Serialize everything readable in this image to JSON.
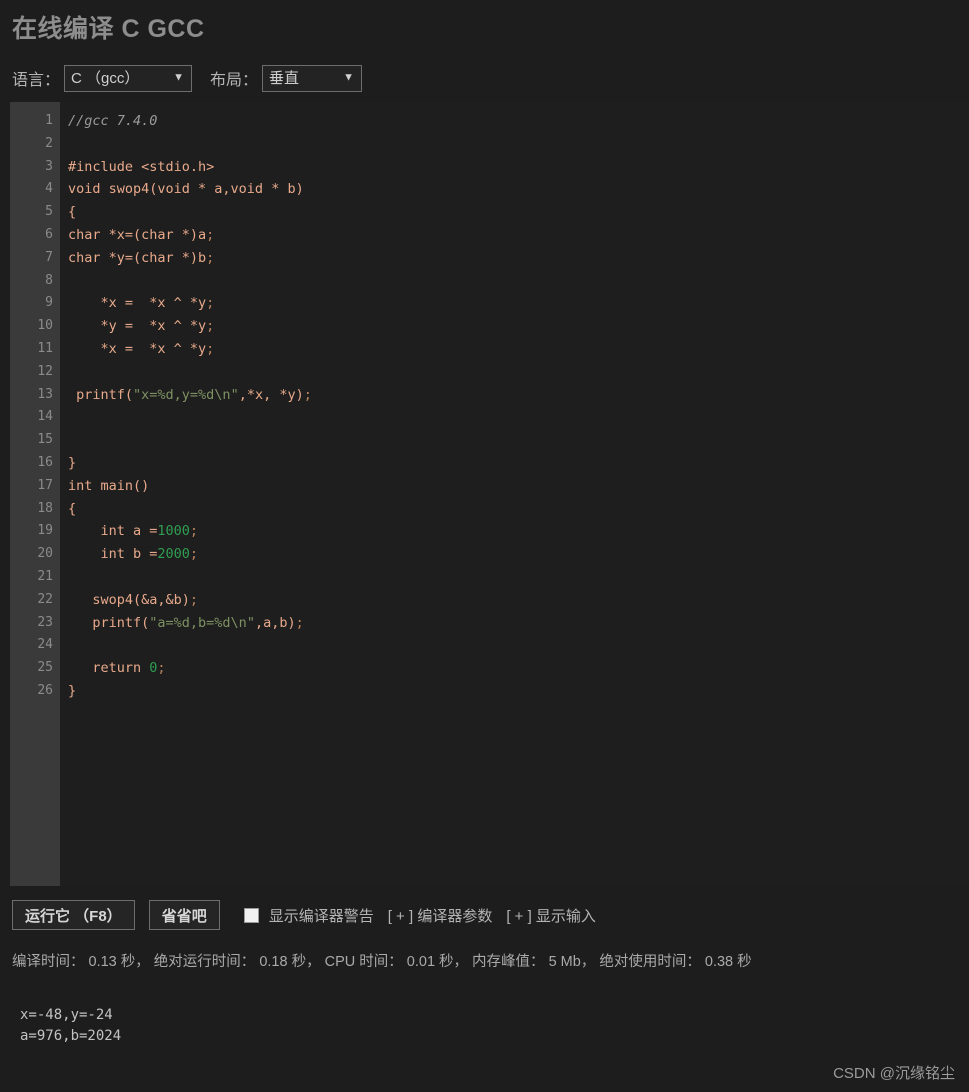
{
  "header": {
    "title": "在线编译 C GCC"
  },
  "options": {
    "language_label": "语言：",
    "language_value": "C （gcc）",
    "layout_label": "布局：",
    "layout_value": "垂直",
    "chevron_icon": "chevron-down-icon"
  },
  "editor": {
    "line_numbers": [
      "1",
      "2",
      "3",
      "4",
      "5",
      "6",
      "7",
      "8",
      "9",
      "10",
      "11",
      "12",
      "13",
      "14",
      "15",
      "16",
      "17",
      "18",
      "19",
      "20",
      "21",
      "22",
      "23",
      "24",
      "25",
      "26"
    ],
    "lines": [
      "//gcc 7.4.0",
      "",
      "#include <stdio.h>",
      "void swop4(void * a,void * b)",
      "{",
      "char *x=(char *)a;",
      "char *y=(char *)b;",
      "",
      "    *x =  *x ^ *y;",
      "    *y =  *x ^ *y;",
      "    *x =  *x ^ *y;",
      "",
      " printf(\"x=%d,y=%d\\n\",*x, *y);",
      "",
      "",
      "}",
      "int main()",
      "{",
      "    int a =1000;",
      "    int b =2000;",
      "",
      "   swop4(&a,&b);",
      "   printf(\"a=%d,b=%d\\n\",a,b);",
      "",
      "   return 0;",
      "}"
    ]
  },
  "actions": {
    "run_label": "运行它 （F8）",
    "cancel_label": "省省吧",
    "show_warnings_label": "显示编译器警告",
    "compiler_args_label": "[ + ] 编译器参数",
    "show_input_label": "[ + ] 显示输入",
    "warnings_checked": false
  },
  "stats": {
    "text": "编译时间： 0.13 秒， 绝对运行时间： 0.18 秒， CPU 时间： 0.01 秒， 内存峰值： 5 Mb， 绝对使用时间： 0.38 秒",
    "compile_time_label": "编译时间：",
    "compile_time": "0.13 秒",
    "absolute_run_time_label": "绝对运行时间：",
    "absolute_run_time": "0.18 秒",
    "cpu_time_label": "CPU 时间：",
    "cpu_time": "0.01 秒",
    "memory_peak_label": "内存峰值：",
    "memory_peak": "5 Mb",
    "absolute_use_time_label": "绝对使用时间：",
    "absolute_use_time": "0.38 秒"
  },
  "output": {
    "text": "x=-48,y=-24\na=976,b=2024",
    "line1": "x=-48,y=-24",
    "line2": "a=976,b=2024"
  },
  "watermark": {
    "text": "CSDN @沉缘铭尘"
  },
  "colors": {
    "page_background": "#1d1d1d",
    "editor_background": "#1e1e1e",
    "gutter_background": "#3a3a3a",
    "code_default": "#e8a98b",
    "code_comment": "#9a9a9a",
    "code_string": "#7d9163",
    "code_number": "#2f9e52",
    "title_color": "#8d8d8d",
    "border_color": "#6d6d6d"
  }
}
